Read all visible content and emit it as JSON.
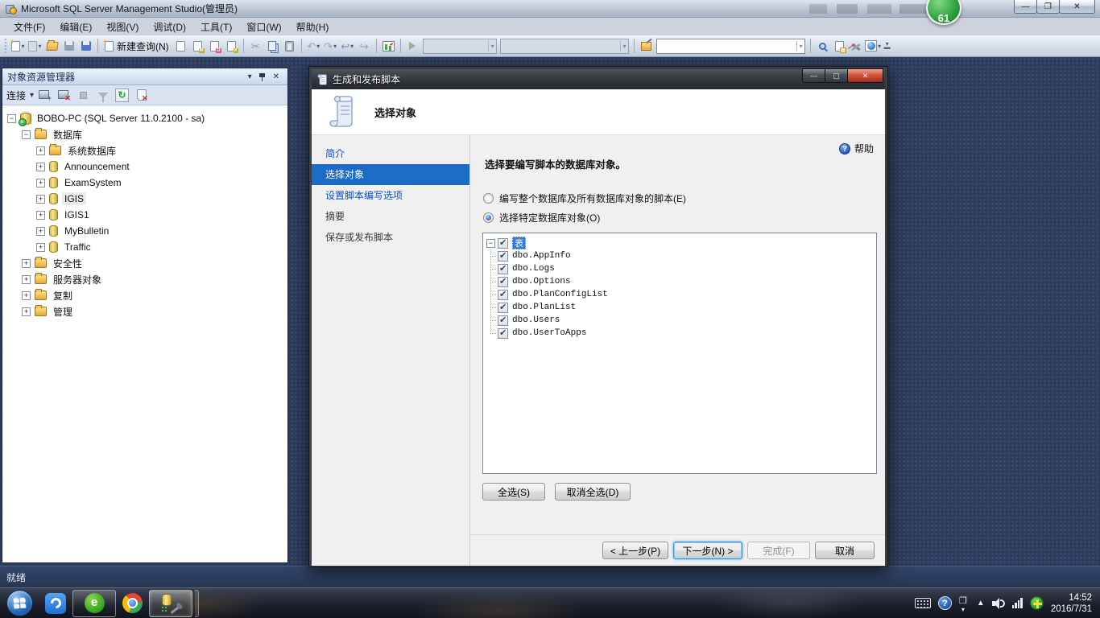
{
  "app": {
    "title": "Microsoft SQL Server Management Studio(管理员)",
    "overlay_badge": "61",
    "status": "就绪"
  },
  "menu": {
    "items": [
      "文件(F)",
      "编辑(E)",
      "视图(V)",
      "调试(D)",
      "工具(T)",
      "窗口(W)",
      "帮助(H)"
    ]
  },
  "toolbar": {
    "new_query_label": "新建查询(N)"
  },
  "object_explorer": {
    "title": "对象资源管理器",
    "connect_label": "连接",
    "tree": [
      "BOBO-PC (SQL Server 11.0.2100 - sa)",
      "数据库",
      "系统数据库",
      "Announcement",
      "ExamSystem",
      "IGIS",
      "IGIS1",
      "MyBulletin",
      "Traffic",
      "安全性",
      "服务器对象",
      "复制",
      "管理"
    ]
  },
  "wizard": {
    "title": "生成和发布脚本",
    "page_title": "选择对象",
    "help_label": "帮助",
    "nav": [
      "简介",
      "选择对象",
      "设置脚本编写选项",
      "摘要",
      "保存或发布脚本"
    ],
    "heading": "选择要编写脚本的数据库对象。",
    "radio_entire": "编写整个数据库及所有数据库对象的脚本(E)",
    "radio_specific": "选择特定数据库对象(O)",
    "tree_root": "表",
    "tables": [
      "dbo.AppInfo",
      "dbo.Logs",
      "dbo.Options",
      "dbo.PlanConfigList",
      "dbo.PlanList",
      "dbo.Users",
      "dbo.UserToApps"
    ],
    "select_all": "全选(S)",
    "deselect_all": "取消全选(D)",
    "back": "< 上一步(P)",
    "next": "下一步(N) >",
    "finish": "完成(F)",
    "cancel": "取消"
  },
  "taskbar": {
    "time": "14:52",
    "date": "2016/7/31"
  },
  "colors": {
    "accent_blue": "#1c6bc7",
    "link_blue": "#0a50c0",
    "selection_blue": "#2e7ce0",
    "close_red": "#c0392b",
    "badge_green": "#2f9e3f"
  }
}
